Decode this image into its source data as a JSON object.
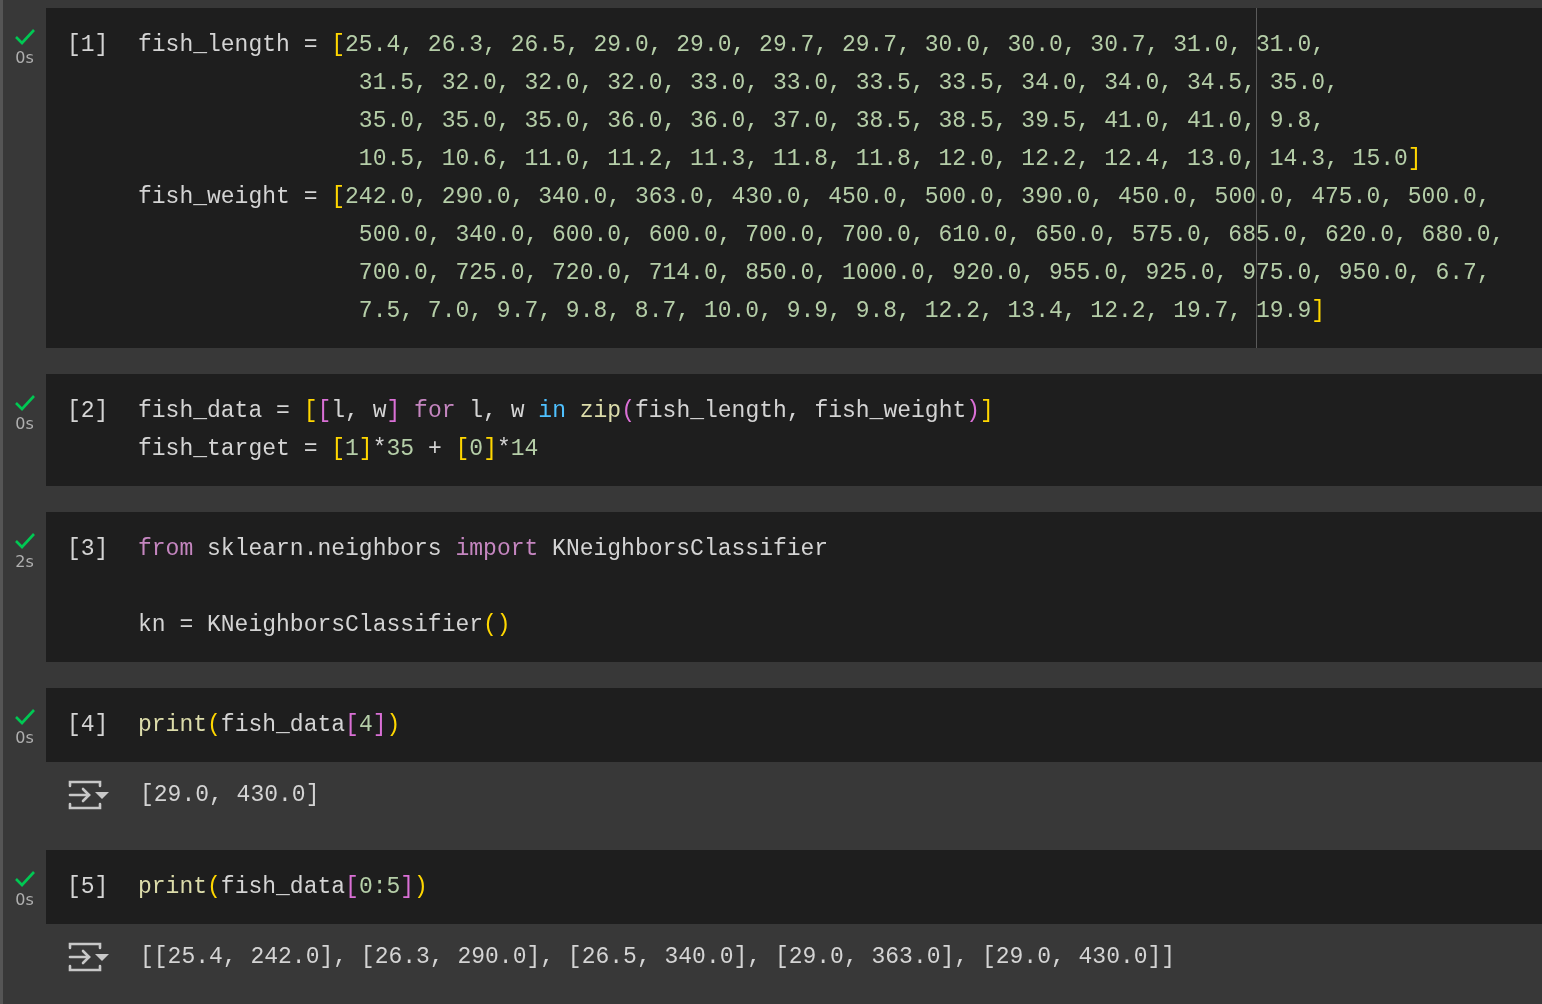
{
  "cells": [
    {
      "count": "[1]",
      "time": "0s",
      "ruler": true,
      "lines": [
        {
          "continuation": false,
          "tokens": [
            {
              "text": "fish_length = ",
              "kind": "plain"
            },
            {
              "text": "[",
              "kind": "bracket"
            },
            {
              "text": "25.4, 26.3, 26.5, 29.0, 29.0, 29.7, 29.7, 30.0, 30.0, 30.7, 31.0, 31.0,",
              "kind": "number"
            }
          ]
        },
        {
          "continuation": true,
          "tokens": [
            {
              "text": "31.5, 32.0, 32.0, 32.0, 33.0, 33.0, 33.5, 33.5, 34.0, 34.0, 34.5, 35.0,",
              "kind": "number"
            }
          ]
        },
        {
          "continuation": true,
          "tokens": [
            {
              "text": "35.0, 35.0, 35.0, 36.0, 36.0, 37.0, 38.5, 38.5, 39.5, 41.0, 41.0, 9.8,",
              "kind": "number"
            }
          ]
        },
        {
          "continuation": true,
          "tokens": [
            {
              "text": "10.5, 10.6, 11.0, 11.2, 11.3, 11.8, 11.8, 12.0, 12.2, 12.4, 13.0, 14.3, 15.0",
              "kind": "number"
            },
            {
              "text": "]",
              "kind": "bracket"
            }
          ]
        },
        {
          "continuation": false,
          "tokens": [
            {
              "text": "fish_weight = ",
              "kind": "plain"
            },
            {
              "text": "[",
              "kind": "bracket"
            },
            {
              "text": "242.0, 290.0, 340.0, 363.0, 430.0, 450.0, 500.0, 390.0, 450.0, 500.0, 475.0, 500.0,",
              "kind": "number"
            }
          ]
        },
        {
          "continuation": true,
          "tokens": [
            {
              "text": "500.0, 340.0, 600.0, 600.0, 700.0, 700.0, 610.0, 650.0, 575.0, 685.0, 620.0, 680.0,",
              "kind": "number"
            }
          ]
        },
        {
          "continuation": true,
          "tokens": [
            {
              "text": "700.0, 725.0, 720.0, 714.0, 850.0, 1000.0, 920.0, 955.0, 925.0, 975.0, 950.0, 6.7,",
              "kind": "number"
            }
          ]
        },
        {
          "continuation": true,
          "tokens": [
            {
              "text": "7.5, 7.0, 9.7, 9.8, 8.7, 10.0, 9.9, 9.8, 12.2, 13.4, 12.2, 19.7, 19.9",
              "kind": "number"
            },
            {
              "text": "]",
              "kind": "bracket"
            }
          ]
        }
      ]
    },
    {
      "count": "[2]",
      "time": "0s",
      "lines": [
        {
          "continuation": false,
          "tokens": [
            {
              "text": "fish_data = ",
              "kind": "plain"
            },
            {
              "text": "[",
              "kind": "bracket"
            },
            {
              "text": "[",
              "kind": "bracket2"
            },
            {
              "text": "l, w",
              "kind": "plain"
            },
            {
              "text": "]",
              "kind": "bracket2"
            },
            {
              "text": " for",
              "kind": "keyword"
            },
            {
              "text": " l, w ",
              "kind": "plain"
            },
            {
              "text": "in",
              "kind": "operator"
            },
            {
              "text": " zip",
              "kind": "function"
            },
            {
              "text": "(",
              "kind": "bracket2"
            },
            {
              "text": "fish_length, fish_weight",
              "kind": "plain"
            },
            {
              "text": ")",
              "kind": "bracket2"
            },
            {
              "text": "]",
              "kind": "bracket"
            }
          ]
        },
        {
          "continuation": false,
          "tokens": [
            {
              "text": "fish_target = ",
              "kind": "plain"
            },
            {
              "text": "[",
              "kind": "bracket"
            },
            {
              "text": "1",
              "kind": "number"
            },
            {
              "text": "]",
              "kind": "bracket"
            },
            {
              "text": "*",
              "kind": "plain"
            },
            {
              "text": "35",
              "kind": "number"
            },
            {
              "text": " + ",
              "kind": "plain"
            },
            {
              "text": "[",
              "kind": "bracket"
            },
            {
              "text": "0",
              "kind": "number"
            },
            {
              "text": "]",
              "kind": "bracket"
            },
            {
              "text": "*",
              "kind": "plain"
            },
            {
              "text": "14",
              "kind": "number"
            }
          ]
        }
      ]
    },
    {
      "count": "[3]",
      "time": "2s",
      "lines": [
        {
          "continuation": false,
          "tokens": [
            {
              "text": "from",
              "kind": "keyword"
            },
            {
              "text": " sklearn.neighbors ",
              "kind": "plain"
            },
            {
              "text": "import",
              "kind": "keyword"
            },
            {
              "text": " KNeighborsClassifier",
              "kind": "plain"
            }
          ]
        },
        {
          "continuation": false,
          "blank_before": true,
          "tokens": [
            {
              "text": "kn = KNeighborsClassifier",
              "kind": "plain"
            },
            {
              "text": "()",
              "kind": "bracket"
            }
          ]
        }
      ]
    },
    {
      "count": "[4]",
      "time": "0s",
      "lines": [
        {
          "continuation": false,
          "tokens": [
            {
              "text": "print",
              "kind": "function"
            },
            {
              "text": "(",
              "kind": "bracket"
            },
            {
              "text": "fish_data",
              "kind": "plain"
            },
            {
              "text": "[",
              "kind": "bracket2"
            },
            {
              "text": "4",
              "kind": "number"
            },
            {
              "text": "]",
              "kind": "bracket2"
            },
            {
              "text": ")",
              "kind": "bracket"
            }
          ]
        }
      ],
      "output": "[29.0, 430.0]"
    },
    {
      "count": "[5]",
      "time": "0s",
      "lines": [
        {
          "continuation": false,
          "tokens": [
            {
              "text": "print",
              "kind": "function"
            },
            {
              "text": "(",
              "kind": "bracket"
            },
            {
              "text": "fish_data",
              "kind": "plain"
            },
            {
              "text": "[",
              "kind": "bracket2"
            },
            {
              "text": "0:5",
              "kind": "number"
            },
            {
              "text": "]",
              "kind": "bracket2"
            },
            {
              "text": ")",
              "kind": "bracket"
            }
          ]
        }
      ],
      "output": "[[25.4, 242.0], [26.3, 290.0], [26.5, 340.0], [29.0, 363.0], [29.0, 430.0]]"
    }
  ]
}
